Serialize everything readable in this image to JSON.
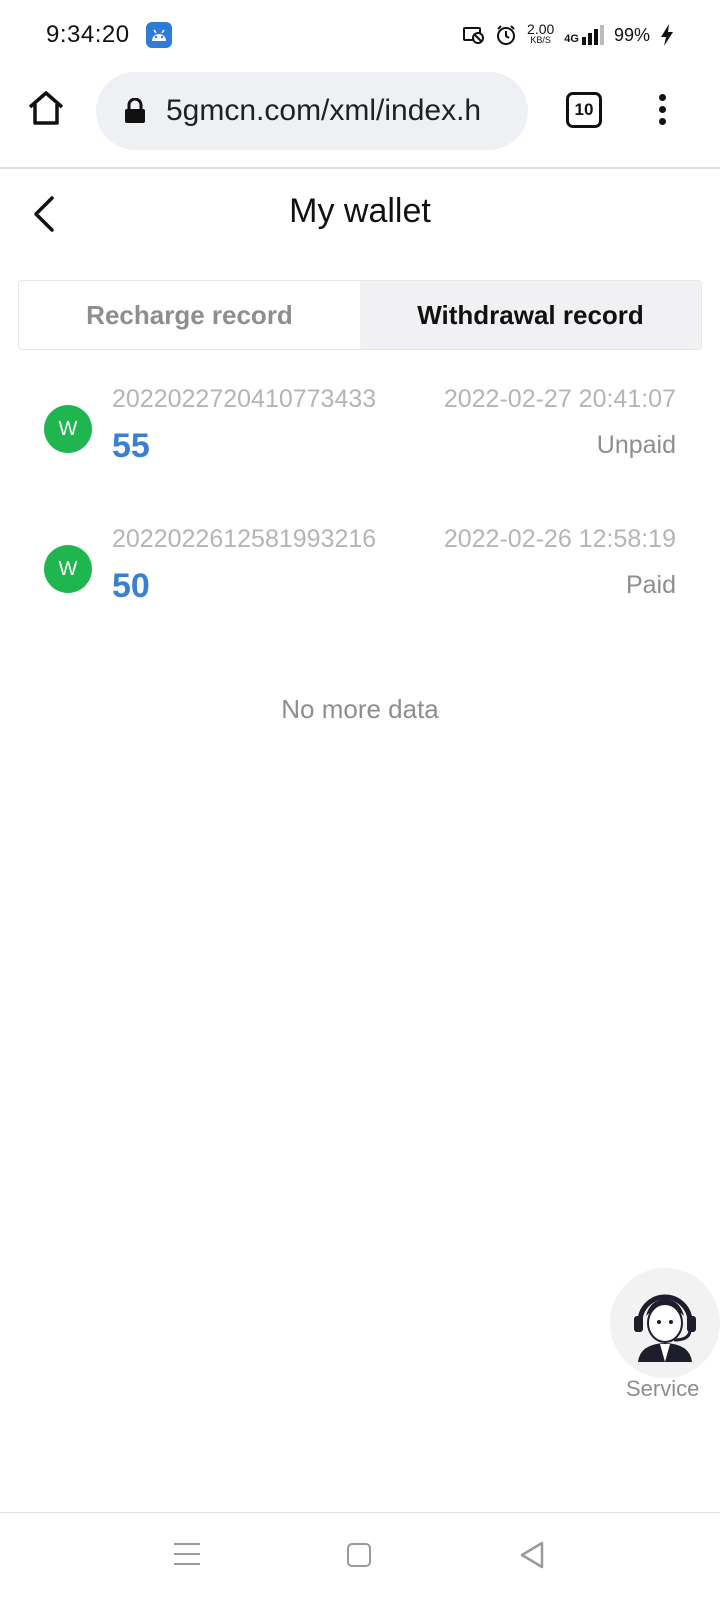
{
  "status_bar": {
    "time": "9:34:20",
    "speed_value": "2.00",
    "speed_unit": "KB/S",
    "network": "4G",
    "battery": "99%"
  },
  "browser": {
    "url": "5gmcn.com/xml/index.h",
    "tab_count": "10"
  },
  "header": {
    "title": "My wallet"
  },
  "tabs": [
    {
      "label": "Recharge record",
      "active": false
    },
    {
      "label": "Withdrawal record",
      "active": true
    }
  ],
  "records": [
    {
      "avatar_letter": "W",
      "id": "2022022720410773433",
      "time": "2022-02-27 20:41:07",
      "amount": "55",
      "status": "Unpaid"
    },
    {
      "avatar_letter": "W",
      "id": "2022022612581993216",
      "time": "2022-02-26 12:58:19",
      "amount": "50",
      "status": "Paid"
    }
  ],
  "list_footer": "No more data",
  "service": {
    "label": "Service"
  },
  "colors": {
    "amount_blue": "#3b7fd4",
    "avatar_green": "#1fb64f",
    "muted_gray": "#8e8e8e"
  }
}
